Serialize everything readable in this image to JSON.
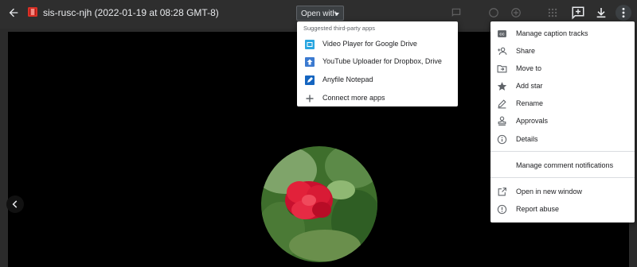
{
  "header": {
    "file_name": "sis-rusc-njh (2022-01-19 at 08:28 GMT-8)",
    "open_with_label": "Open with"
  },
  "open_with_menu": {
    "header": "Suggested third-party apps",
    "items": [
      {
        "label": "Video Player for Google Drive",
        "icon": "video-player-app-icon"
      },
      {
        "label": "YouTube Uploader for Dropbox, Drive",
        "icon": "youtube-uploader-app-icon"
      },
      {
        "label": "Anyfile Notepad",
        "icon": "anyfile-notepad-app-icon"
      },
      {
        "label": "Connect more apps",
        "icon": "plus-icon"
      }
    ]
  },
  "more_menu": {
    "items": [
      {
        "label": "Manage caption tracks",
        "icon": "closed-caption-icon"
      },
      {
        "label": "Share",
        "icon": "person-add-icon"
      },
      {
        "label": "Move to",
        "icon": "move-to-folder-icon"
      },
      {
        "label": "Add star",
        "icon": "star-icon"
      },
      {
        "label": "Rename",
        "icon": "pencil-icon"
      },
      {
        "label": "Approvals",
        "icon": "stamp-icon"
      },
      {
        "label": "Details",
        "icon": "info-icon"
      },
      {
        "label": "Manage comment notifications",
        "icon": ""
      },
      {
        "label": "Open in new window",
        "icon": "open-in-new-icon"
      },
      {
        "label": "Report abuse",
        "icon": "report-icon"
      }
    ]
  },
  "colors": {
    "file_icon": "#d93025",
    "app_blue": "#1a73e8",
    "topbar": "#2e2e2e",
    "viewer": "#000000"
  }
}
